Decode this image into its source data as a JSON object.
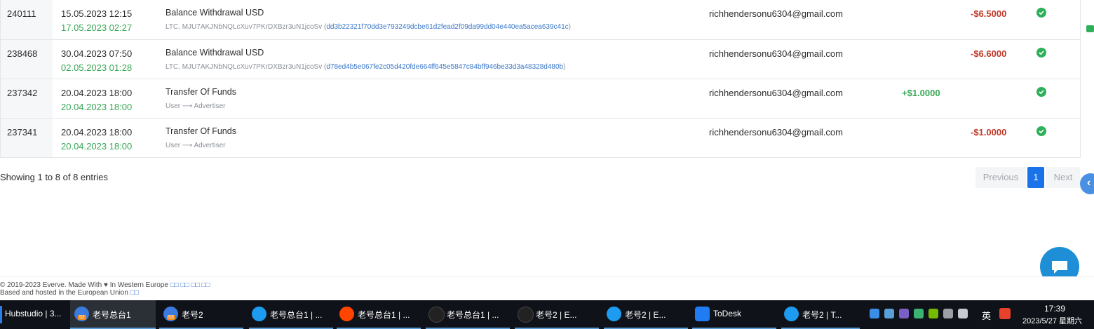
{
  "rows": [
    {
      "id": "240111",
      "created": "15.05.2023 12:15",
      "completed": "17.05.2023 02:27",
      "type": "Balance Withdrawal USD",
      "details": "LTC, MJU7AKJNbNQLcXuv7PKrDXBzr3uN1jcoSv (",
      "hash": "dd3b22321f70dd3e793249dcbe61d2fead2f09da99dd04e440ea5acea639c41c",
      "details_end": ")",
      "email": "richhendersonu6304@gmail.com",
      "amount_in": "",
      "amount_out": "-$6.5000"
    },
    {
      "id": "238468",
      "created": "30.04.2023 07:50",
      "completed": "02.05.2023 01:28",
      "type": "Balance Withdrawal USD",
      "details": "LTC, MJU7AKJNbNQLcXuv7PKrDXBzr3uN1jcoSv (",
      "hash": "d78ed4b5e067fe2c05d420fde664ff645e5847c84bff946be33d3a48328d480b",
      "details_end": ")",
      "email": "richhendersonu6304@gmail.com",
      "amount_in": "",
      "amount_out": "-$6.6000"
    },
    {
      "id": "237342",
      "created": "20.04.2023 18:00",
      "completed": "20.04.2023 18:00",
      "type": "Transfer Of Funds",
      "details": "User ⟶ Advertiser",
      "hash": "",
      "details_end": "",
      "email": "richhendersonu6304@gmail.com",
      "amount_in": "+$1.0000",
      "amount_out": ""
    },
    {
      "id": "237341",
      "created": "20.04.2023 18:00",
      "completed": "20.04.2023 18:00",
      "type": "Transfer Of Funds",
      "details": "User ⟶ Advertiser",
      "hash": "",
      "details_end": "",
      "email": "richhendersonu6304@gmail.com",
      "amount_in": "",
      "amount_out": "-$1.0000"
    }
  ],
  "pagination": {
    "summary": "Showing 1 to 8 of 8 entries",
    "previous": "Previous",
    "current": "1",
    "next": "Next"
  },
  "footer": {
    "line1": "© 2019-2023 Everve. Made With ♥ In Western Europe",
    "line1_links": "□□ □□ □□ □□",
    "line2": "Based and hosted in the European Union",
    "line2_link": "□□"
  },
  "taskbar": {
    "items": [
      {
        "label": "Hubstudio | 3...",
        "icon": "hubstudio-icon",
        "color": "#2b7de9"
      },
      {
        "label": "老号总台1",
        "icon": "browser-profile-icon",
        "color": "#3b7be0",
        "badge": "52"
      },
      {
        "label": "老号2",
        "icon": "browser-profile-icon",
        "color": "#3b7be0",
        "badge": "53"
      },
      {
        "label": "老号总台1 | ...",
        "icon": "twitter-icon",
        "color": "#1d9bf0"
      },
      {
        "label": "老号总台1 | ...",
        "icon": "reddit-icon",
        "color": "#ff4500"
      },
      {
        "label": "老号总台1 | ...",
        "icon": "tiktok-icon",
        "color": "#111111"
      },
      {
        "label": "老号2 | E...",
        "icon": "tiktok-icon",
        "color": "#111111"
      },
      {
        "label": "老号2 | E...",
        "icon": "twitter-icon",
        "color": "#1d9bf0"
      },
      {
        "label": "ToDesk",
        "icon": "todesk-icon",
        "color": "#1f7cf2"
      },
      {
        "label": "老号2 | T...",
        "icon": "twitter-icon",
        "color": "#1d9bf0"
      }
    ],
    "ime": "英",
    "time": "17:39",
    "date": "2023/5/27 星期六"
  }
}
